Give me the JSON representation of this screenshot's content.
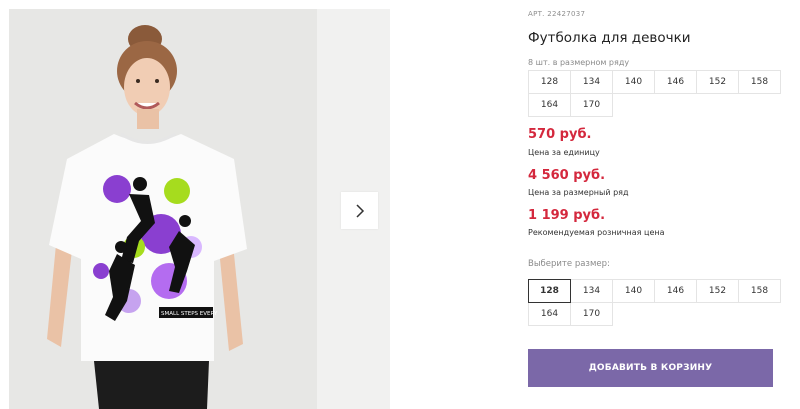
{
  "product": {
    "article": "АРТ. 22427037",
    "title": "Футболка для девочки"
  },
  "row_sizes": {
    "note": "8 шт. в размерном ряду",
    "items": [
      "128",
      "134",
      "140",
      "146",
      "152",
      "158",
      "164",
      "170"
    ]
  },
  "prices": [
    {
      "amount": "570 руб.",
      "label": "Цена за единицу"
    },
    {
      "amount": "4 560 руб.",
      "label": "Цена за размерный ряд"
    },
    {
      "amount": "1 199 руб.",
      "label": "Рекомендуемая розничная цена"
    }
  ],
  "size_select": {
    "label": "Выберите размер:",
    "options": [
      "128",
      "134",
      "140",
      "146",
      "152",
      "158",
      "164",
      "170"
    ],
    "selected": "128"
  },
  "cart_button": "ДОБАВИТЬ В КОРЗИНУ",
  "print_text": "SMALL STEPS EVERY",
  "colors": {
    "price": "#d4283d",
    "button": "#7b68a8",
    "print_purple": "#8a3fd0",
    "print_lime": "#a6dc1e"
  }
}
